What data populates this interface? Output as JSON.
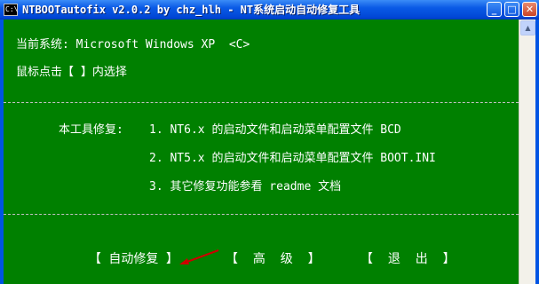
{
  "window": {
    "icon_text": "C:\\",
    "title": "NTBOOTautofix v2.0.2 by chz_hlh - NT系统启动自动修复工具",
    "controls": {
      "minimize": "_",
      "maximize": "□",
      "close": "✕"
    }
  },
  "console": {
    "current_system": "当前系统: Microsoft Windows XP  <C>",
    "instruction": "鼠标点击【 】内选择",
    "separator": "------------------------------------------------------------------------",
    "tool_repair_label": "本工具修复:",
    "items": [
      "1. NT6.x 的启动文件和启动菜单配置文件 BCD",
      "2. NT5.x 的启动文件和启动菜单配置文件 BOOT.INI",
      "3. 其它修复功能参看 readme 文档"
    ]
  },
  "buttons": {
    "auto_repair": "【 自动修复 】",
    "advanced": "【  高  级  】",
    "exit": "【  退  出  】"
  },
  "scrollbar": {
    "up_arrow": "▲"
  },
  "colors": {
    "console_bg": "#008000",
    "text": "#ffffff",
    "title_bar": "#0054e3",
    "pointer": "#cc0000"
  }
}
